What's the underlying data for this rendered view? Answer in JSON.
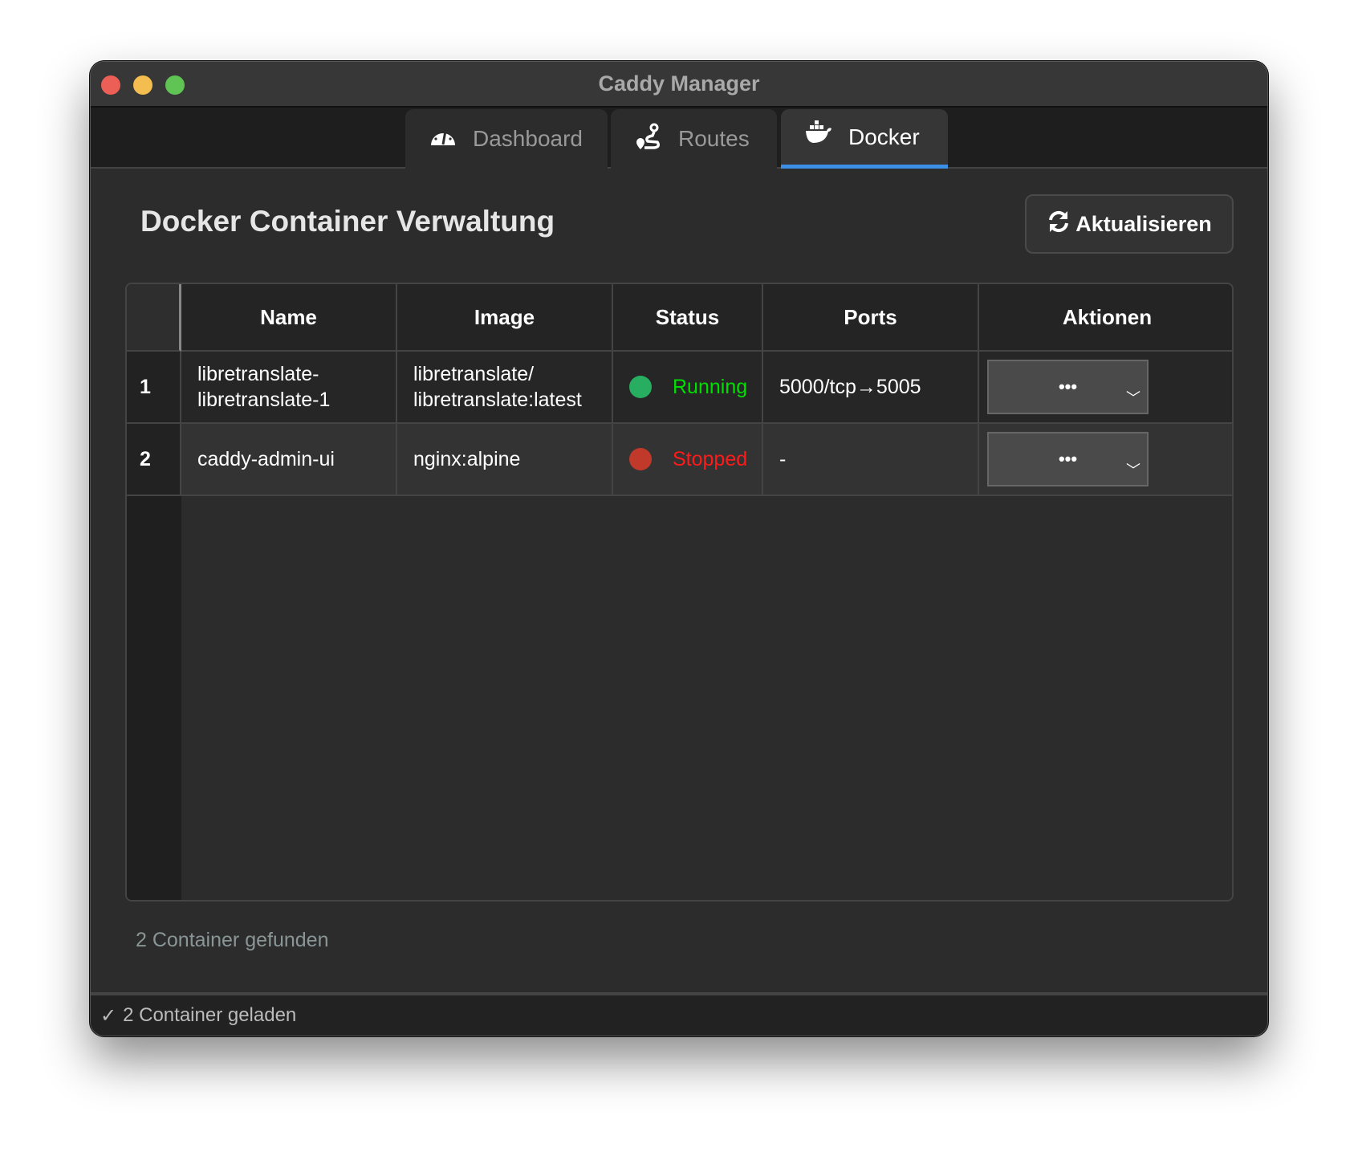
{
  "window": {
    "title": "Caddy Manager"
  },
  "tabs": [
    {
      "label": "Dashboard",
      "icon": "gauge-icon",
      "active": false
    },
    {
      "label": "Routes",
      "icon": "route-icon",
      "active": false
    },
    {
      "label": "Docker",
      "icon": "docker-icon",
      "active": true
    }
  ],
  "main": {
    "heading": "Docker Container Verwaltung",
    "refresh_label": "Aktualisieren",
    "found_text": "2 Container gefunden"
  },
  "table": {
    "columns": [
      "Name",
      "Image",
      "Status",
      "Ports",
      "Aktionen"
    ],
    "rows": [
      {
        "num": "1",
        "name_l1": "libretranslate-",
        "name_l2": "libretranslate-1",
        "image_l1": "libretranslate/",
        "image_l2": "libretranslate:latest",
        "status": "Running",
        "status_color": "#00e000",
        "dot_color": "#27ae60",
        "ports": "5000/tcp→5005",
        "action": "•••"
      },
      {
        "num": "2",
        "name_l1": "caddy-admin-ui",
        "image_l1": "nginx:alpine",
        "status": "Stopped",
        "status_color": "#ff1a1a",
        "dot_color": "#c0392b",
        "ports": "-",
        "action": "•••"
      }
    ]
  },
  "statusbar": {
    "check": "✓",
    "text": "2 Container geladen"
  },
  "colors": {
    "accent": "#3b8fe6"
  }
}
